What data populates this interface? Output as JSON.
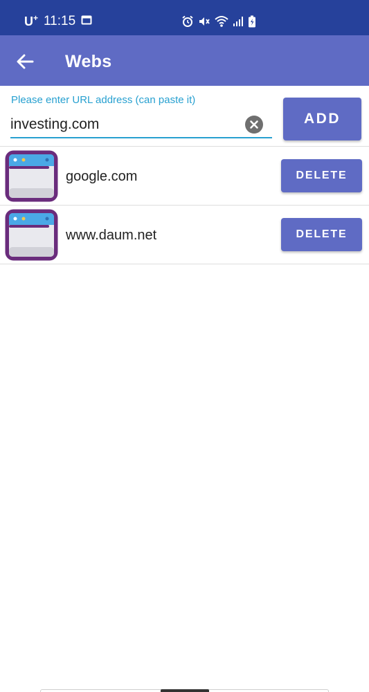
{
  "status_bar": {
    "carrier": "U",
    "carrier_sup": "+",
    "time": "11:15",
    "bg_color": "#26419b"
  },
  "app_bar": {
    "title": "Webs",
    "back_icon": "arrow-back-icon",
    "bg_color": "#5f6bc4"
  },
  "url_form": {
    "label": "Please enter URL address (can paste it)",
    "value": "investing.com",
    "clear_icon": "clear-circle-icon",
    "add_label": "ADD",
    "accent_color": "#27a0d0"
  },
  "webs": [
    {
      "name": "google.com",
      "icon": "browser-window-icon",
      "delete_label": "DELETE"
    },
    {
      "name": "www.daum.net",
      "icon": "browser-window-icon",
      "delete_label": "DELETE"
    }
  ]
}
